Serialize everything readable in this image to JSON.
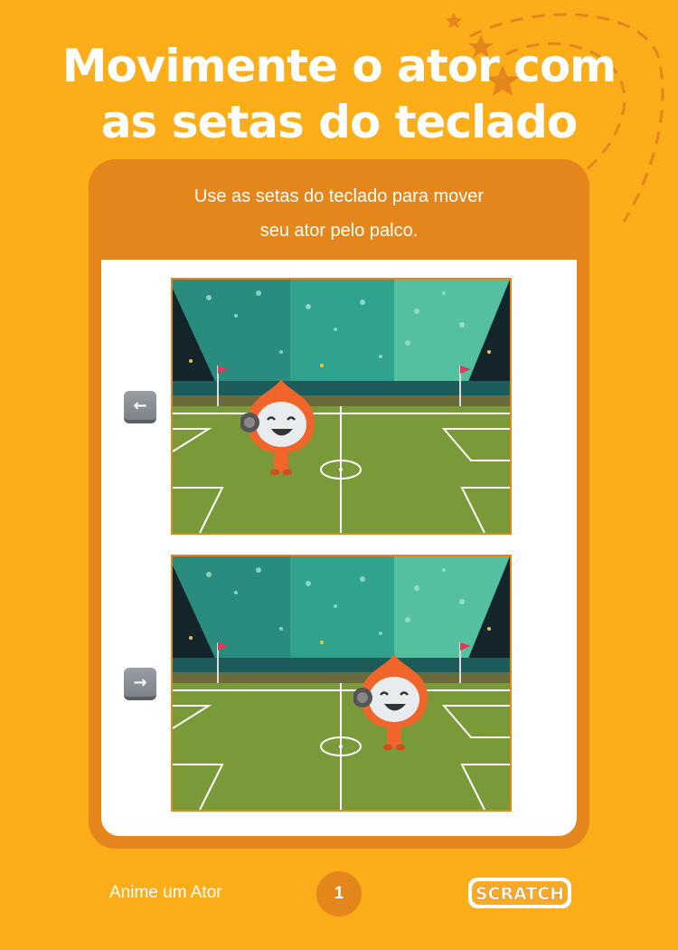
{
  "title": {
    "line1": "Movimente o ator com",
    "line2": "as setas do teclado"
  },
  "card": {
    "line1": "Use as setas do teclado para mover",
    "line2": "seu ator pelo palco."
  },
  "steps": [
    {
      "key_icon": "left-arrow-key-icon",
      "key_glyph": "←",
      "sprite_position": "left"
    },
    {
      "key_icon": "right-arrow-key-icon",
      "key_glyph": "→",
      "sprite_position": "right"
    }
  ],
  "footer": {
    "title": "Anime um Ator",
    "page_number": "1",
    "logo_text": "SCRATCH"
  },
  "colors": {
    "background": "#fbad1a",
    "card": "#e5861c",
    "pitch": "#7a9a3a",
    "sprite": "#f0652a",
    "crowd_teal": "#2a9d8f"
  }
}
